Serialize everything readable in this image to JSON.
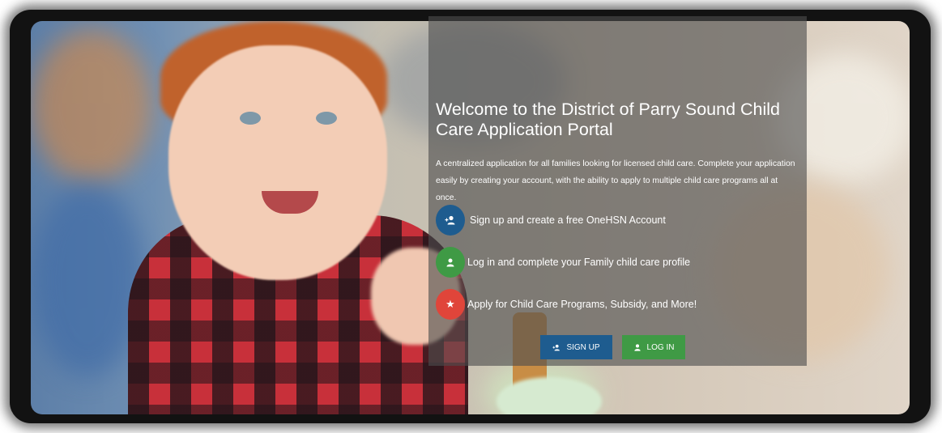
{
  "portal": {
    "title": "Welcome to the District of Parry Sound Child Care Application Portal",
    "description": "A centralized application for all families looking for licensed child care. Complete your application easily by creating your account, with the ability to apply to multiple child care programs all at once."
  },
  "steps": [
    {
      "label": "Sign up and create a free OneHSN Account",
      "icon": "add-user-icon",
      "color": "#1e5c8f"
    },
    {
      "label": "Log in and complete your Family child care profile",
      "icon": "user-icon",
      "color": "#3f9a45"
    },
    {
      "label": "Apply for Child Care Programs, Subsidy, and More!",
      "icon": "star-icon",
      "color": "#e0453a"
    }
  ],
  "buttons": {
    "signup": {
      "label": "SIGN UP",
      "icon": "add-user-icon",
      "color": "#1e5c8f"
    },
    "login": {
      "label": "LOG IN",
      "icon": "user-icon",
      "color": "#3f9a45"
    }
  }
}
